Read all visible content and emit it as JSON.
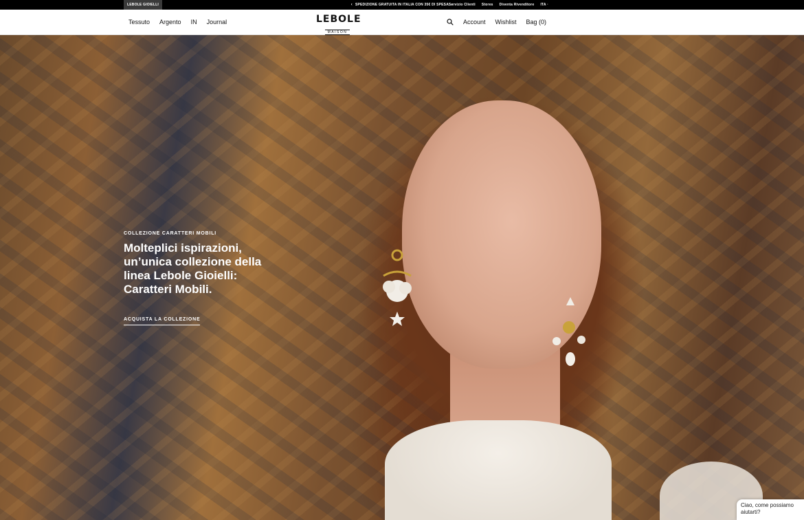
{
  "topbar": {
    "brand_tab": "LEBOLE GIOIELLI",
    "promo": "SPEDIZIONE GRATUITA IN ITALIA CON 35€ DI SPESA",
    "promo_prev": "‹",
    "promo_next": "›",
    "utils": [
      "Servizio Clienti",
      "Stores",
      "Diventa Rivenditore",
      "ITA ·"
    ]
  },
  "header": {
    "nav_left": [
      "Tessuto",
      "Argento",
      "IN",
      "Journal"
    ],
    "logo_main": "LEBOLE",
    "logo_sub": "MAISON",
    "nav_right": [
      "Account",
      "Wishlist",
      "Bag (0)"
    ],
    "search_icon": "search-icon"
  },
  "hero": {
    "eyebrow": "COLLEZIONE CARATTERI MOBILI",
    "headline": "Molteplici ispirazioni, un’unica collezione della linea Lebole Gioielli: Caratteri Mobili.",
    "cta": "ACQUISTA LA COLLEZIONE"
  },
  "chat": {
    "text": "Ciao, come possiamo aiutarti?"
  },
  "colors": {
    "topbar_bg": "#000000",
    "header_bg": "#ffffff",
    "text_dark": "#111111",
    "hero_text": "#ffffff"
  }
}
